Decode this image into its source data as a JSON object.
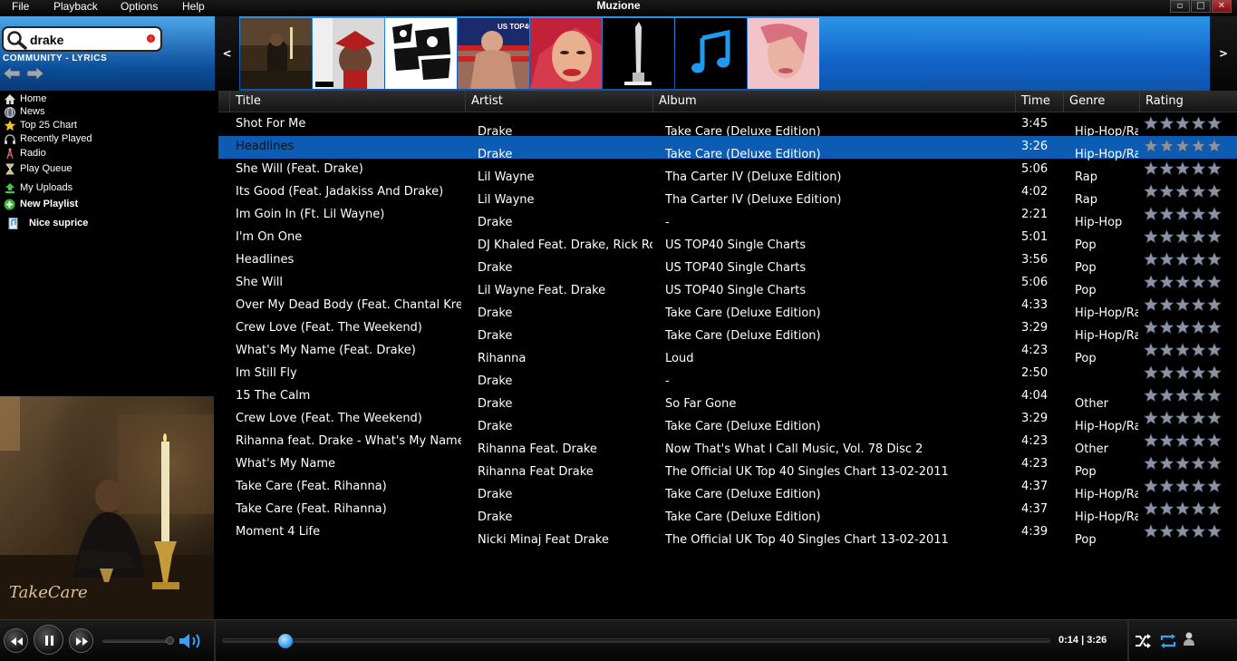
{
  "window": {
    "title": "Muzione",
    "menu": [
      "File",
      "Playback",
      "Options",
      "Help"
    ],
    "controls": {
      "minimize": "▫",
      "maximize": "□",
      "close": "✕"
    }
  },
  "search": {
    "value": "drake",
    "links": "COMMUNITY - LYRICS"
  },
  "carousel": {
    "prev": "<",
    "next": ">"
  },
  "sidebar": {
    "items": [
      {
        "label": "Home",
        "icon": "home-icon"
      },
      {
        "label": "News",
        "icon": "news-icon"
      },
      {
        "label": "Top 25 Chart",
        "icon": "star-icon"
      },
      {
        "label": "Recently Played",
        "icon": "headphones-icon"
      },
      {
        "label": "Radio",
        "icon": "radio-icon"
      },
      {
        "label": "Play Queue",
        "icon": "hourglass-icon"
      },
      {
        "label": "My Uploads",
        "icon": "upload-icon"
      }
    ],
    "new_playlist": "New Playlist",
    "playlists": [
      "Nice suprice"
    ]
  },
  "table": {
    "headers": [
      "Title",
      "Artist",
      "Album",
      "Time",
      "Genre",
      "Rating"
    ],
    "selected_index": 1,
    "rows": [
      {
        "title": "Shot For Me",
        "artist": "Drake",
        "album": "Take Care (Deluxe Edition)",
        "time": "3:45",
        "genre": "Hip-Hop/Ra"
      },
      {
        "title": "Headlines",
        "artist": "Drake",
        "album": "Take Care (Deluxe Edition)",
        "time": "3:26",
        "genre": "Hip-Hop/Ra"
      },
      {
        "title": "She Will (Feat. Drake)",
        "artist": "Lil Wayne",
        "album": "Tha Carter IV (Deluxe Edition)",
        "time": "5:06",
        "genre": "Rap"
      },
      {
        "title": "Its Good (Feat. Jadakiss And Drake)",
        "artist": "Lil Wayne",
        "album": "Tha Carter IV (Deluxe Edition)",
        "time": "4:02",
        "genre": "Rap"
      },
      {
        "title": "Im Goin In (Ft. Lil Wayne)",
        "artist": "Drake",
        "album": "-",
        "time": "2:21",
        "genre": "Hip-Hop"
      },
      {
        "title": "I'm On One",
        "artist": "DJ Khaled Feat. Drake, Rick Ros",
        "album": "US TOP40 Single Charts",
        "time": "5:01",
        "genre": "Pop"
      },
      {
        "title": "Headlines",
        "artist": "Drake",
        "album": "US TOP40 Single Charts",
        "time": "3:56",
        "genre": "Pop"
      },
      {
        "title": "She Will",
        "artist": "Lil Wayne Feat. Drake",
        "album": "US TOP40 Single Charts",
        "time": "5:06",
        "genre": "Pop"
      },
      {
        "title": "Over My Dead Body (Feat. Chantal Krevi",
        "artist": "Drake",
        "album": "Take Care (Deluxe Edition)",
        "time": "4:33",
        "genre": "Hip-Hop/Ra"
      },
      {
        "title": "Crew Love (Feat. The Weekend)",
        "artist": "Drake",
        "album": "Take Care (Deluxe Edition)",
        "time": "3:29",
        "genre": "Hip-Hop/Ra"
      },
      {
        "title": "What's My Name (Feat. Drake)",
        "artist": "Rihanna",
        "album": "Loud",
        "time": "4:23",
        "genre": "Pop"
      },
      {
        "title": "Im Still Fly",
        "artist": "Drake",
        "album": "-",
        "time": "2:50",
        "genre": ""
      },
      {
        "title": "15 The Calm",
        "artist": "Drake",
        "album": "So Far Gone",
        "time": "4:04",
        "genre": "Other"
      },
      {
        "title": "Crew Love (Feat. The Weekend)",
        "artist": "Drake",
        "album": "Take Care (Deluxe Edition)",
        "time": "3:29",
        "genre": "Hip-Hop/Ra"
      },
      {
        "title": "Rihanna feat. Drake - What's My Name?",
        "artist": "Rihanna Feat. Drake",
        "album": "Now That's What I Call Music, Vol. 78 Disc 2",
        "time": "4:23",
        "genre": "Other"
      },
      {
        "title": "What's My Name",
        "artist": "Rihanna Feat Drake",
        "album": "The Official UK Top 40 Singles Chart 13-02-2011",
        "time": "4:23",
        "genre": "Pop"
      },
      {
        "title": "Take Care (Feat. Rihanna)",
        "artist": "Drake",
        "album": "Take Care (Deluxe Edition)",
        "time": "4:37",
        "genre": "Hip-Hop/Ra"
      },
      {
        "title": "Take Care (Feat. Rihanna)",
        "artist": "Drake",
        "album": "Take Care (Deluxe Edition)",
        "time": "4:37",
        "genre": "Hip-Hop/Ra"
      },
      {
        "title": "Moment 4 Life",
        "artist": "Nicki Minaj Feat Drake",
        "album": "The Official UK Top 40 Singles Chart 13-02-2011",
        "time": "4:39",
        "genre": "Pop"
      }
    ]
  },
  "player": {
    "time": "0:14 | 3:26",
    "progress": 0.0753,
    "volume": 1.0
  },
  "colors": {
    "accent": "#0d5cb3",
    "header_blue": "#1264c8",
    "star": "#8a93a4"
  }
}
